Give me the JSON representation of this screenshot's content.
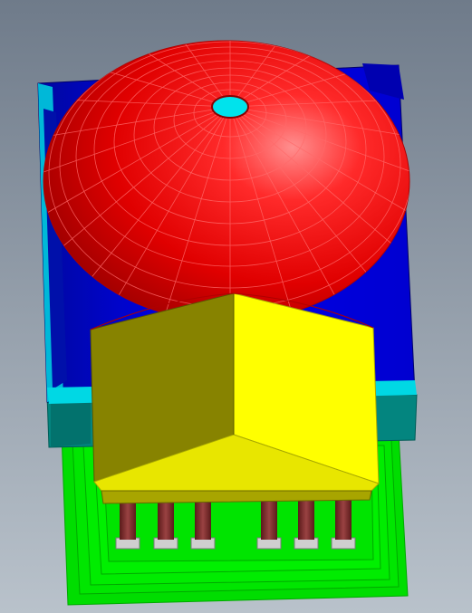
{
  "scene": {
    "background_gradient": [
      "#6f7b8a",
      "#b9c2cb"
    ],
    "parts": [
      {
        "name": "dome",
        "color": "#ee0000",
        "edge_color": "#ff6a6a"
      },
      {
        "name": "dome-hole",
        "color": "#00e3ec"
      },
      {
        "name": "housing-box",
        "color": "#0000ee"
      },
      {
        "name": "housing-trim",
        "color": "#00d8e4"
      },
      {
        "name": "teal-base",
        "color": "#03857f"
      },
      {
        "name": "green-pcb",
        "color": "#00e000"
      },
      {
        "name": "yellow-block",
        "color": "#ffff00",
        "shade_color": "#878300"
      },
      {
        "name": "pins",
        "color": "#7e2a2a"
      }
    ],
    "pin_count": 6
  }
}
